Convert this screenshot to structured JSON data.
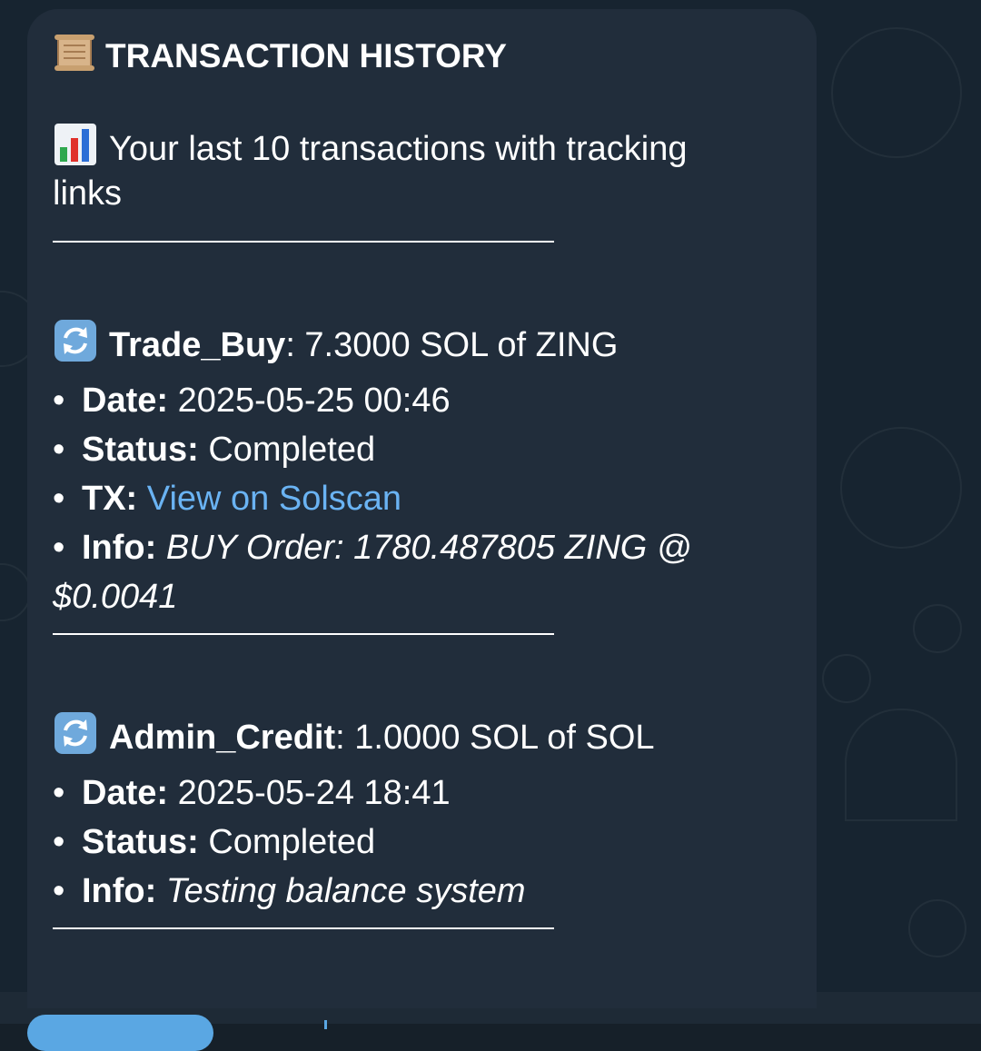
{
  "message": {
    "title": "TRANSACTION HISTORY",
    "title_icon": "scroll-icon",
    "subtitle": "Your last 10 transactions with tracking",
    "subtitle_cont": "links",
    "subtitle_icon": "bar-chart-icon",
    "separator": "—————————————————",
    "transactions": [
      {
        "icon": "cycle-arrows-icon",
        "type": "Trade_Buy",
        "amount": ": 7.3000 SOL of ZING",
        "date_label": "Date:",
        "date": "2025-05-25 00:46",
        "status_label": "Status:",
        "status": "Completed",
        "tx_label": "TX:",
        "tx_link": "View on Solscan",
        "info_label": "Info:",
        "info": "BUY Order: 1780.487805 ZING @",
        "info_cont": "$0.0041"
      },
      {
        "icon": "cycle-arrows-icon",
        "type": "Admin_Credit",
        "amount": ": 1.0000 SOL of SOL",
        "date_label": "Date:",
        "date": "2025-05-24 18:41",
        "status_label": "Status:",
        "status": "Completed",
        "info_label": "Info:",
        "info": "Testing balance system"
      }
    ]
  },
  "colors": {
    "background": "#172430",
    "bubble": "#212d3b",
    "text": "#ffffff",
    "link": "#6ab3f3"
  }
}
